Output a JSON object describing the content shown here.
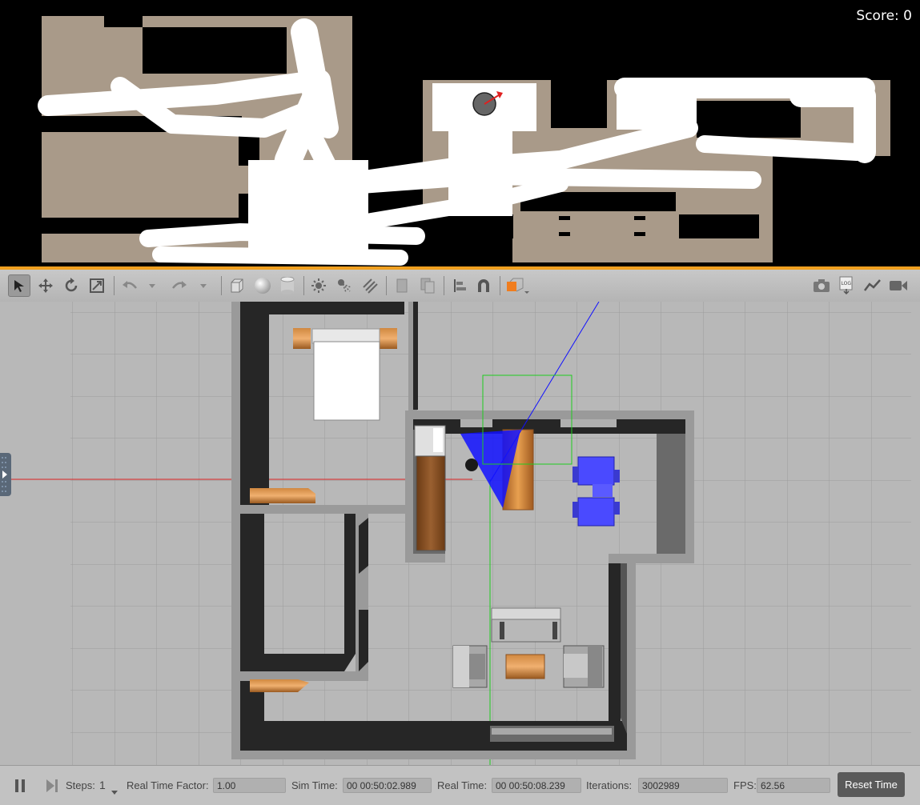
{
  "score": {
    "label": "Score:",
    "value": "0"
  },
  "toolbar": {
    "icons": [
      "select-arrow-icon",
      "translate-icon",
      "rotate-icon",
      "scale-icon",
      "undo-icon",
      "redo-icon",
      "box-icon",
      "sphere-icon",
      "cylinder-icon",
      "point-light-icon",
      "spot-light-icon",
      "directional-light-icon",
      "copy-icon",
      "paste-icon",
      "align-icon",
      "snap-magnet-icon",
      "shape-color-icon",
      "screenshot-icon",
      "log-icon",
      "plot-icon",
      "record-video-icon"
    ],
    "accent": "#f07d1e"
  },
  "bottom_bar": {
    "steps_label": "Steps:",
    "steps_value": "1",
    "rtf_label": "Real Time Factor:",
    "rtf_value": "1.00",
    "sim_time_label": "Sim Time:",
    "sim_time_value": "00 00:50:02.989",
    "real_time_label": "Real Time:",
    "real_time_value": "00 00:50:08.239",
    "iterations_label": "Iterations:",
    "iterations_value": "3002989",
    "fps_label": "FPS:",
    "fps_value": "62.56",
    "reset_label": "Reset Time"
  },
  "colors": {
    "map_free": "#a99a89",
    "map_visited": "#ffffff",
    "wall_dark": "#2a2a2a",
    "wall_light": "#9a9a9a",
    "floor": "#b8b8b8",
    "wood": "#c87a30",
    "chair_blue": "#4a4aff",
    "laser_blue": "#1010ff"
  }
}
